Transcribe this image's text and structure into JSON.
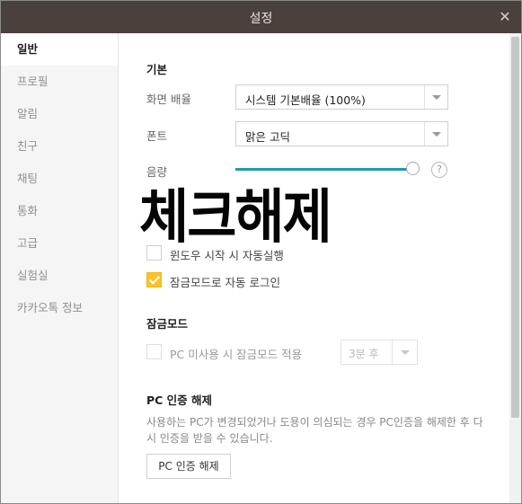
{
  "window": {
    "title": "설정",
    "close_glyph": "✕"
  },
  "sidebar": {
    "items": [
      {
        "label": "일반",
        "active": true
      },
      {
        "label": "프로필"
      },
      {
        "label": "알림"
      },
      {
        "label": "친구"
      },
      {
        "label": "채팅"
      },
      {
        "label": "통화"
      },
      {
        "label": "고급"
      },
      {
        "label": "실험실"
      },
      {
        "label": "카카오톡 정보"
      }
    ]
  },
  "basic": {
    "title": "기본",
    "zoom": {
      "label": "화면 배율",
      "value": "시스템 기본배율 (100%)"
    },
    "font": {
      "label": "폰트",
      "value": "맑은 고딕"
    },
    "volume": {
      "label": "음량",
      "level_percent": 100,
      "help_glyph": "?"
    }
  },
  "overlay": {
    "text": "체크해제"
  },
  "startup": {
    "auto_run_label": "윈도우 시작 시 자동실행",
    "auto_run_checked": false,
    "auto_login_label": "잠금모드로 자동 로그인",
    "auto_login_checked": true
  },
  "lock_mode": {
    "title": "잠금모드",
    "idle_label": "PC 미사용 시 잠금모드 적용",
    "idle_checked": false,
    "idle_time": "3분 후"
  },
  "pc_auth": {
    "title": "PC 인증 해제",
    "description": "사용하는 PC가 변경되었거나 도용이 의심되는 경우 PC인증을 해제한 후 다시 인증을 받을 수 있습니다.",
    "button_label": "PC 인증 해제"
  },
  "colors": {
    "accent": "#1e9bab",
    "check": "#f8c52a",
    "titlebar": "#4a403c"
  }
}
